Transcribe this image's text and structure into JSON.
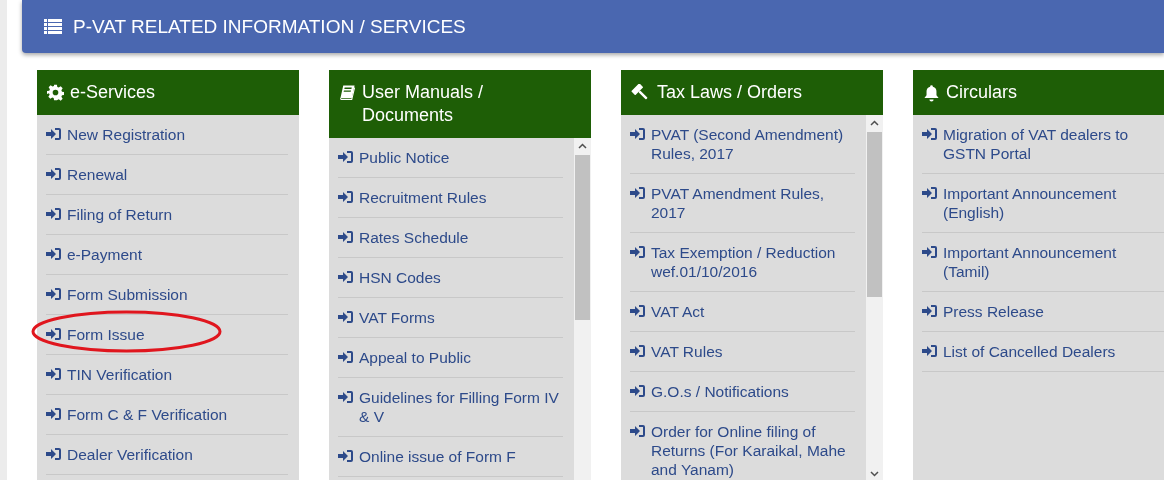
{
  "banner": {
    "title": "P-VAT RELATED INFORMATION / SERVICES"
  },
  "panels": [
    {
      "title": "e-Services",
      "scrollbar": false,
      "items": [
        {
          "label": "New Registration",
          "circled": false
        },
        {
          "label": "Renewal",
          "circled": false
        },
        {
          "label": "Filing of Return",
          "circled": false
        },
        {
          "label": "e-Payment",
          "circled": false
        },
        {
          "label": "Form Submission",
          "circled": false
        },
        {
          "label": "Form Issue",
          "circled": true
        },
        {
          "label": "TIN Verification",
          "circled": false
        },
        {
          "label": "Form C & F Verification",
          "circled": false
        },
        {
          "label": "Dealer Verification",
          "circled": false
        }
      ]
    },
    {
      "title": "User Manuals / Documents",
      "scrollbar": true,
      "items": [
        {
          "label": "Public Notice",
          "circled": false
        },
        {
          "label": "Recruitment Rules",
          "circled": false
        },
        {
          "label": "Rates Schedule",
          "circled": false
        },
        {
          "label": "HSN Codes",
          "circled": false
        },
        {
          "label": "VAT Forms",
          "circled": false
        },
        {
          "label": "Appeal to Public",
          "circled": false
        },
        {
          "label": "Guidelines for Filling Form IV & V",
          "circled": false
        },
        {
          "label": "Online issue of Form F",
          "circled": false
        }
      ]
    },
    {
      "title": "Tax Laws / Orders",
      "scrollbar": true,
      "items": [
        {
          "label": "PVAT (Second Amendment) Rules, 2017",
          "circled": false
        },
        {
          "label": "PVAT Amendment Rules, 2017",
          "circled": false
        },
        {
          "label": "Tax Exemption / Reduction wef.01/10/2016",
          "circled": false
        },
        {
          "label": "VAT Act",
          "circled": false
        },
        {
          "label": "VAT Rules",
          "circled": false
        },
        {
          "label": "G.O.s / Notifications",
          "circled": false
        },
        {
          "label": "Order for Online filing of Returns (For Karaikal, Mahe and Yanam)",
          "circled": false
        }
      ]
    },
    {
      "title": "Circulars",
      "scrollbar": false,
      "items": [
        {
          "label": "Migration of VAT dealers to GSTN Portal",
          "circled": false
        },
        {
          "label": "Important Announcement (English)",
          "circled": false
        },
        {
          "label": "Important Announcement (Tamil)",
          "circled": false
        },
        {
          "label": "Press Release",
          "circled": false
        },
        {
          "label": "List of Cancelled Dealers",
          "circled": false
        }
      ]
    }
  ]
}
